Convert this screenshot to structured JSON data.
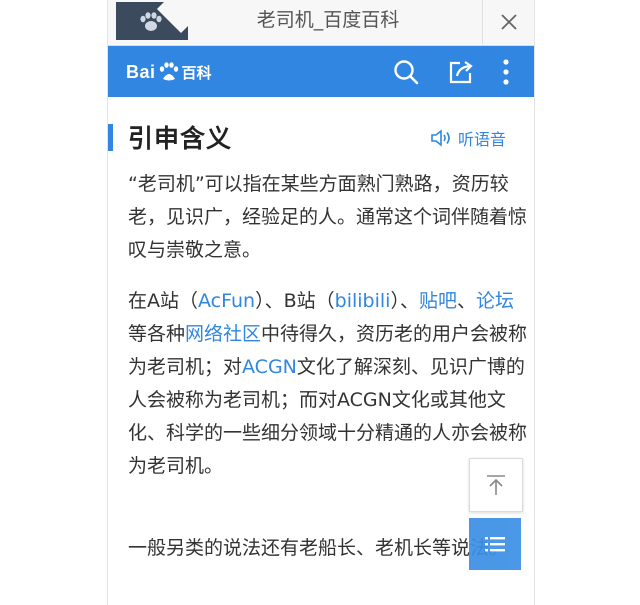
{
  "tab": {
    "title": "老司机_百度百科",
    "favicon": "paw-icon",
    "close": "close-icon"
  },
  "header": {
    "logo_text_1": "Bai",
    "logo_text_2": "百科",
    "logo_icon": "baidu-paw-icon",
    "icons": [
      "search-icon",
      "share-icon",
      "more-icon"
    ],
    "color": "#3086e0"
  },
  "section": {
    "title": "引申含义",
    "listen_label": "听语音",
    "listen_icon": "speaker-icon"
  },
  "content": {
    "p1": "“老司机”可以指在某些方面熟门熟路，资历较老，见识广，经验足的人。通常这个词伴随着惊叹与崇敬之意。",
    "p2": {
      "t1": "在A站（",
      "l1": "AcFun",
      "t2": "）、B站（",
      "l2": "bilibili",
      "t3": "）、",
      "l3": "贴吧",
      "t4": "、",
      "l4": "论坛",
      "t5": "等各种",
      "l5": "网络社区",
      "t6": "中待得久，资历老的用户会被称为老司机；对",
      "l6": "ACGN",
      "t7": "文化了解深刻、见识广博的人会被称为老司机；而对ACGN文化或其他文化、科学的一些细分领域十分精通的人亦会被称为老司机。"
    },
    "p3": "一般另类的说法还有老船长、老机长等说法。"
  },
  "float": {
    "top_icon": "back-to-top-icon",
    "menu_icon": "menu-icon"
  }
}
